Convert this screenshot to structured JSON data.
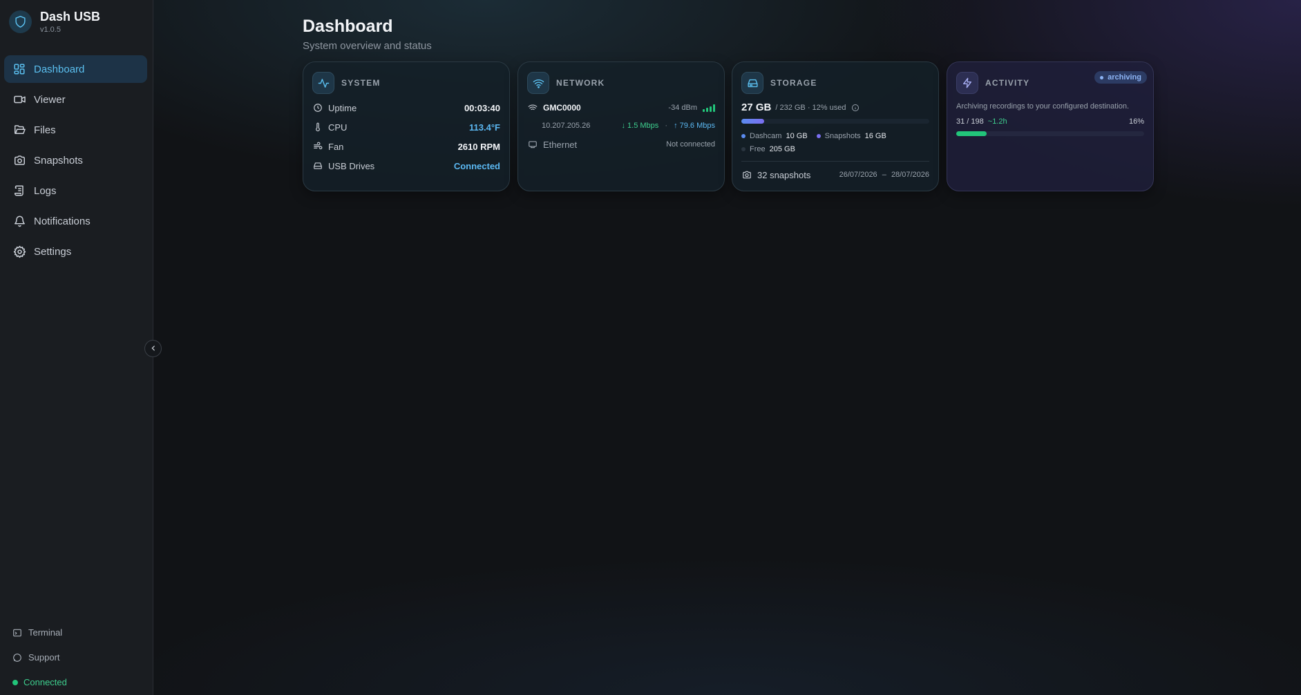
{
  "app": {
    "name": "Dash USB",
    "version": "v1.0.5"
  },
  "sidebar": {
    "items": [
      {
        "label": "Dashboard",
        "icon": "dashboard-icon",
        "active": true
      },
      {
        "label": "Viewer",
        "icon": "video-icon"
      },
      {
        "label": "Files",
        "icon": "folder-icon"
      },
      {
        "label": "Snapshots",
        "icon": "camera-icon"
      },
      {
        "label": "Logs",
        "icon": "scroll-icon"
      },
      {
        "label": "Notifications",
        "icon": "bell-icon"
      },
      {
        "label": "Settings",
        "icon": "gear-icon"
      }
    ],
    "footer": {
      "terminal": "Terminal",
      "support": "Support",
      "status": "Connected"
    }
  },
  "page": {
    "title": "Dashboard",
    "subtitle": "System overview and status"
  },
  "system": {
    "title": "SYSTEM",
    "uptime_label": "Uptime",
    "uptime": "00:03:40",
    "cpu_label": "CPU",
    "cpu": "113.4°F",
    "fan_label": "Fan",
    "fan": "2610 RPM",
    "usb_label": "USB Drives",
    "usb": "Connected"
  },
  "network": {
    "title": "NETWORK",
    "ssid": "GMC0000",
    "signal": "-34 dBm",
    "signal_bars": 4,
    "ip": "10.207.205.26",
    "down": "↓ 1.5 Mbps",
    "sep": "·",
    "up": "↑ 79.6 Mbps",
    "ethernet_label": "Ethernet",
    "ethernet_status": "Not connected"
  },
  "storage": {
    "title": "STORAGE",
    "used": "27 GB",
    "total_text": "/ 232 GB · 12% used",
    "used_fraction": 0.12,
    "dashcam_label": "Dashcam",
    "dashcam": "10 GB",
    "snapshots_label": "Snapshots",
    "snapshots": "16 GB",
    "free_label": "Free",
    "free": "205 GB",
    "snapshot_count": "32 snapshots",
    "date_from": "26/07/2026",
    "date_sep": "–",
    "date_to": "28/07/2026"
  },
  "activity": {
    "title": "ACTIVITY",
    "badge": "archiving",
    "description": "Archiving recordings to your configured destination.",
    "count": "31 / 198",
    "eta": "~1.2h",
    "percent": "16%",
    "progress_fraction": 0.16
  },
  "colors": {
    "accent": "#5bc0f0",
    "success": "#22c57a",
    "dashcam": "#5b8cf0",
    "snapshots": "#7b6ff0"
  }
}
